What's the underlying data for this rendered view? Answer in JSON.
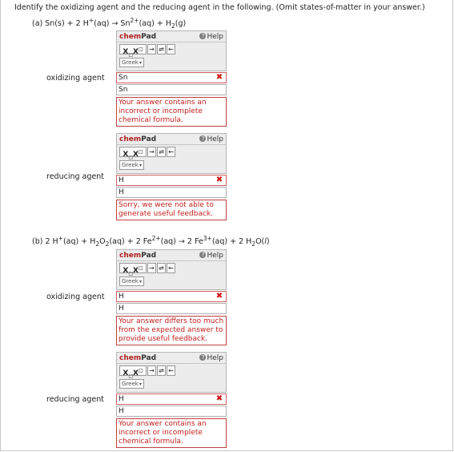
{
  "question": "Identify the oxidizing agent and the reducing agent in the following. (Omit states-of-matter in your answer.)",
  "part_a": {
    "equation": {
      "prefix": "(a) Sn(s) + 2 H",
      "sup1": "+",
      "mid1": "(aq) → Sn",
      "sup2": "2+",
      "mid2": "(aq) + H",
      "sub1": "2",
      "suffix": "(g)"
    },
    "oxidizing": {
      "label": "oxidizing agent",
      "value": "Sn",
      "preview": "Sn",
      "feedback": "Your answer contains an incorrect or incomplete chemical formula."
    },
    "reducing": {
      "label": "reducing agent",
      "value": "H",
      "preview": "H",
      "feedback": "Sorry, we were not able to generate useful feedback."
    }
  },
  "part_b": {
    "equation": {
      "p1": "(b) 2 H",
      "s1": "+",
      "p2": "(aq) + H",
      "b1": "2",
      "p3": "O",
      "b2": "2",
      "p4": "(aq) + 2 Fe",
      "s2": "2+",
      "p5": "(aq) → 2 Fe",
      "s3": "3+",
      "p6": "(aq) + 2 H",
      "b3": "2",
      "p7": "O(",
      "italic_l": "l",
      "p8": ")"
    },
    "oxidizing": {
      "label": "oxidizing agent",
      "value": "H",
      "preview": "H",
      "feedback": "Your answer differs too much from the expected answer to provide useful feedback."
    },
    "reducing": {
      "label": "reducing agent",
      "value": "H",
      "preview": "H",
      "feedback": "Your answer contains an incorrect or incomplete chemical formula."
    }
  },
  "chempad": {
    "title_chem": "chem",
    "title_pad": "Pad",
    "help_label": "Help",
    "help_icon": "?",
    "greek_label": "Greek",
    "subsup_label_x1": "X",
    "subsup_label_x2": "X",
    "arrow_right": "→",
    "arrow_equilibrium": "⇌",
    "arrow_left": "←",
    "dropdown_caret": "▾",
    "error_mark": "✖"
  },
  "colors": {
    "error_red": "#d01010",
    "feedback_red": "#c42020",
    "pad_bg": "#ececec"
  }
}
